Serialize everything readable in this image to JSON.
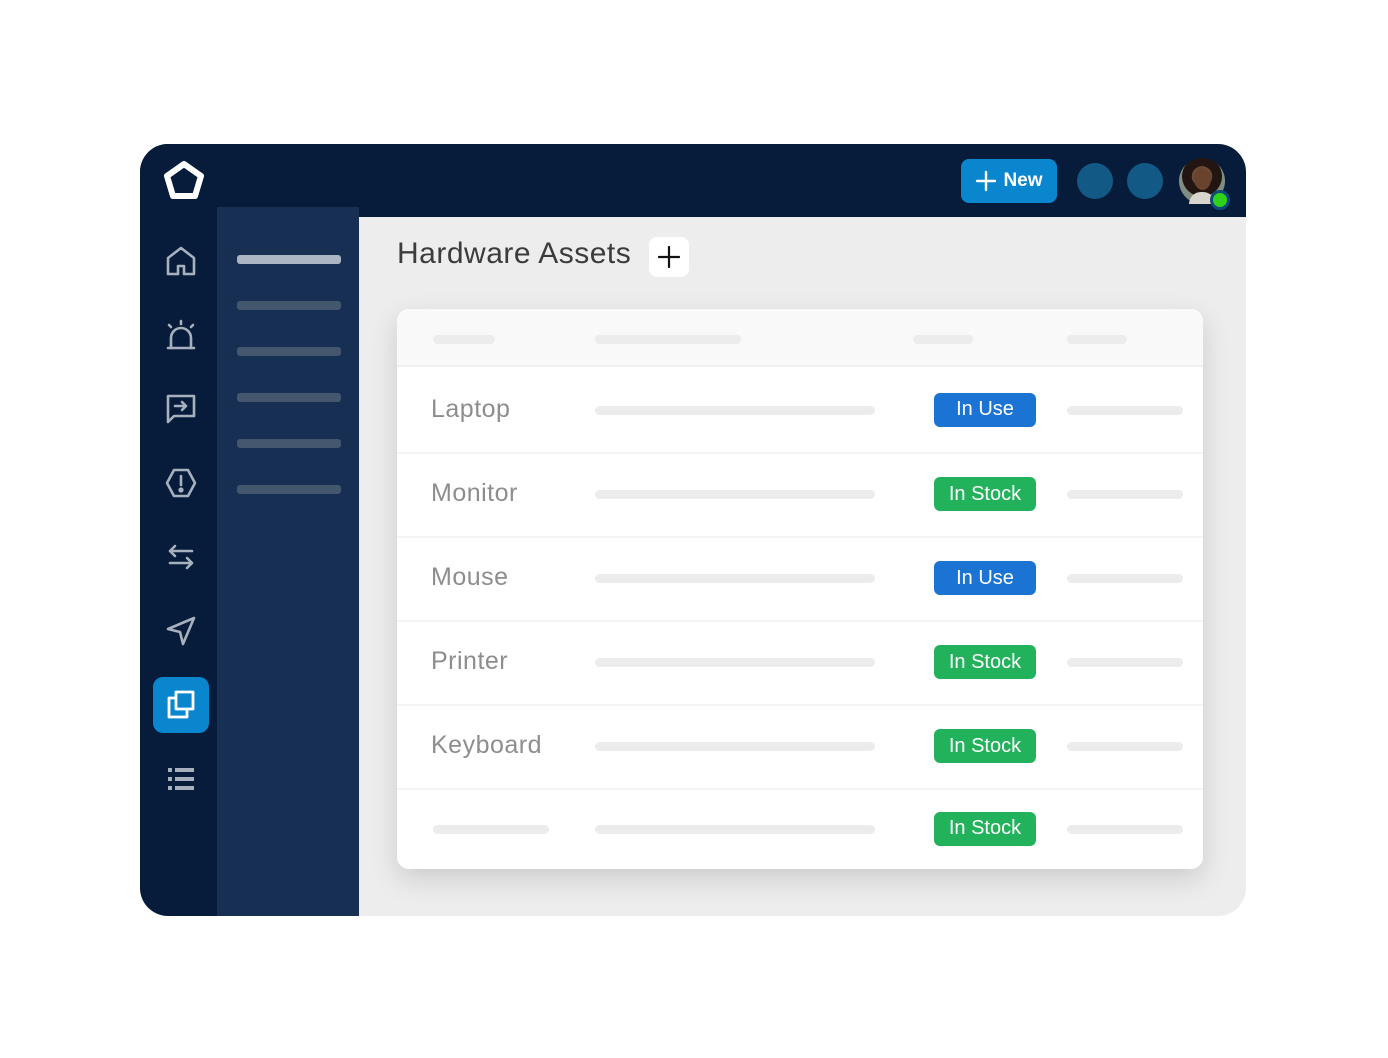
{
  "header": {
    "new_button_label": "New",
    "avatar_status": "online"
  },
  "sidebar": {
    "icons": [
      {
        "name": "home-icon",
        "active": false
      },
      {
        "name": "alarm-icon",
        "active": false
      },
      {
        "name": "message-arrow-icon",
        "active": false
      },
      {
        "name": "alert-hexagon-icon",
        "active": false
      },
      {
        "name": "swap-arrows-icon",
        "active": false
      },
      {
        "name": "send-icon",
        "active": false
      },
      {
        "name": "assets-copy-icon",
        "active": true
      },
      {
        "name": "list-icon",
        "active": false
      }
    ]
  },
  "page": {
    "title": "Hardware Assets",
    "add_button": "+"
  },
  "table": {
    "rows": [
      {
        "name": "Laptop",
        "status": "In Use"
      },
      {
        "name": "Monitor",
        "status": "In Stock"
      },
      {
        "name": "Mouse",
        "status": "In Use"
      },
      {
        "name": "Printer",
        "status": "In Stock"
      },
      {
        "name": "Keyboard",
        "status": "In Stock"
      },
      {
        "name": "",
        "status": "In Stock"
      }
    ]
  },
  "colors": {
    "nav_dark": "#071c3b",
    "subnav": "#172f52",
    "accent": "#0a86cf",
    "in_use": "#1b74d4",
    "in_stock": "#23b25c",
    "online": "#2fd21a"
  }
}
